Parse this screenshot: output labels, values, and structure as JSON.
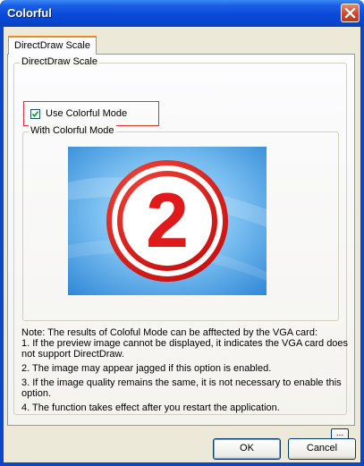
{
  "window": {
    "title": "Colorful"
  },
  "tab": {
    "label": "DirectDraw Scale"
  },
  "group_main": {
    "label": "DirectDraw Scale"
  },
  "checkbox": {
    "label": "Use Colorful Mode",
    "checked": true
  },
  "group_preview": {
    "label": "With Colorful Mode"
  },
  "preview": {
    "digit": "2"
  },
  "notes": [
    "Note: The results of Coloful Mode can be afftected by the VGA card:",
    "1. If the preview image cannot be displayed, it indicates the VGA card does not support DirectDraw.",
    "2. The image may appear jagged if this option is enabled.",
    "3. If the image quality remains the same, it is not necessary to enable this option.",
    "4. The function takes effect after you restart the application."
  ],
  "buttons": {
    "more": "...",
    "ok": "OK",
    "cancel": "Cancel"
  },
  "colors": {
    "titlebar": "#0a4ad8",
    "dialog_bg": "#ece9d8",
    "highlight_border": "#e03030",
    "preview_red": "#e01a1a",
    "preview_blue": "#6ab4ec"
  }
}
